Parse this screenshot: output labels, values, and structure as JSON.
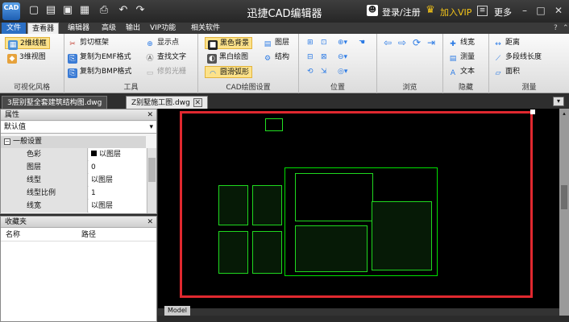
{
  "app": {
    "logo_text": "CAD",
    "title": "迅捷CAD编辑器",
    "login": "登录/注册",
    "vip": "加入VIP",
    "more": "更多"
  },
  "menu": {
    "tabs": [
      "文件",
      "查看器",
      "编辑器",
      "高级",
      "输出",
      "VIP功能",
      "相关软件"
    ]
  },
  "ribbon": {
    "visual": {
      "label": "可视化风格",
      "items": [
        "2维线框",
        "3维视图"
      ]
    },
    "tools": {
      "label": "工具",
      "items": [
        "剪切框架",
        "复制为EMF格式",
        "复制为BMP格式",
        "显示点",
        "查找文字",
        "修剪光栅"
      ]
    },
    "cad": {
      "label": "CAD绘图设置",
      "items": [
        "黑色背景",
        "黑白绘图",
        "圆滑弧形",
        "图层",
        "结构"
      ]
    },
    "position": {
      "label": "位置"
    },
    "browse": {
      "label": "浏览"
    },
    "hide": {
      "label": "隐藏",
      "items": [
        "线宽",
        "测量",
        "文本"
      ]
    },
    "measure": {
      "label": "测量",
      "items": [
        "距离",
        "多段线长度",
        "面积"
      ]
    }
  },
  "doc_tabs": [
    "3层别墅全套建筑结构图.dwg",
    "Z别墅施工图.dwg"
  ],
  "properties": {
    "title": "属性",
    "selector": "默认值",
    "section": "一般设置",
    "rows": [
      {
        "k": "色彩",
        "v": "以图层"
      },
      {
        "k": "图层",
        "v": "0"
      },
      {
        "k": "线型",
        "v": "以图层"
      },
      {
        "k": "线型比例",
        "v": "1"
      },
      {
        "k": "线宽",
        "v": "以图层"
      }
    ]
  },
  "favorites": {
    "title": "收藏夹",
    "col_name": "名称",
    "col_path": "路径"
  },
  "canvas": {
    "layout_tab": "Model"
  },
  "colors": {
    "accent": "#2b6fc4",
    "frame": "#e0282f",
    "drawing": "#00e000"
  }
}
